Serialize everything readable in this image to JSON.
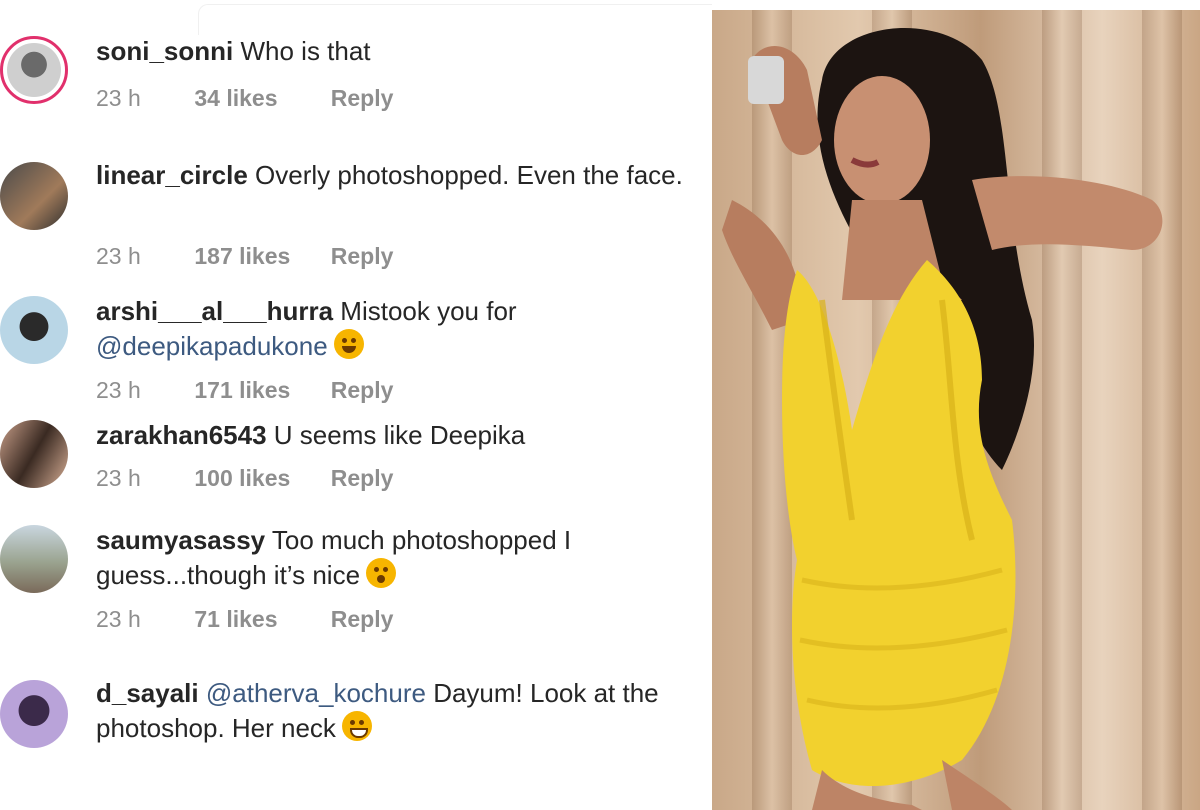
{
  "comments": [
    {
      "username": "soni_sonni",
      "text": "Who is that",
      "time": "23 h",
      "likes": "34 likes",
      "reply": "Reply",
      "avatar": "profile-avatar",
      "story_ring": true
    },
    {
      "username": "linear_circle",
      "text": "Overly photoshopped. Even the face.",
      "time": "23 h",
      "likes": "187 likes",
      "reply": "Reply",
      "avatar": "profile-avatar",
      "story_ring": false
    },
    {
      "username": "arshi___al___hurra",
      "text": "Mistook you for",
      "mention": "@deepikapadukone",
      "emoji": "rolling-laughing-emoji",
      "time": "23 h",
      "likes": "171 likes",
      "reply": "Reply",
      "avatar": "profile-avatar",
      "story_ring": false
    },
    {
      "username": "zarakhan6543",
      "text": "U seems like Deepika",
      "time": "23 h",
      "likes": "100 likes",
      "reply": "Reply",
      "avatar": "profile-avatar",
      "story_ring": false
    },
    {
      "username": "saumyasassy",
      "text": "Too much photoshopped I guess...though it’s nice",
      "emoji": "kissing-face-emoji",
      "time": "23 h",
      "likes": "71 likes",
      "reply": "Reply",
      "avatar": "profile-avatar",
      "story_ring": false
    },
    {
      "username": "d_sayali",
      "mention": "@atherva_kochure",
      "text": "Dayum! Look at the photoshop. Her neck",
      "emoji": "grinning-face-emoji",
      "avatar": "profile-avatar",
      "story_ring": false
    }
  ],
  "colors": {
    "text": "#262626",
    "meta": "#8e8e8e",
    "mention": "#3d5a80",
    "story_ring": "#e1306c",
    "dress": "#f2d12e"
  }
}
